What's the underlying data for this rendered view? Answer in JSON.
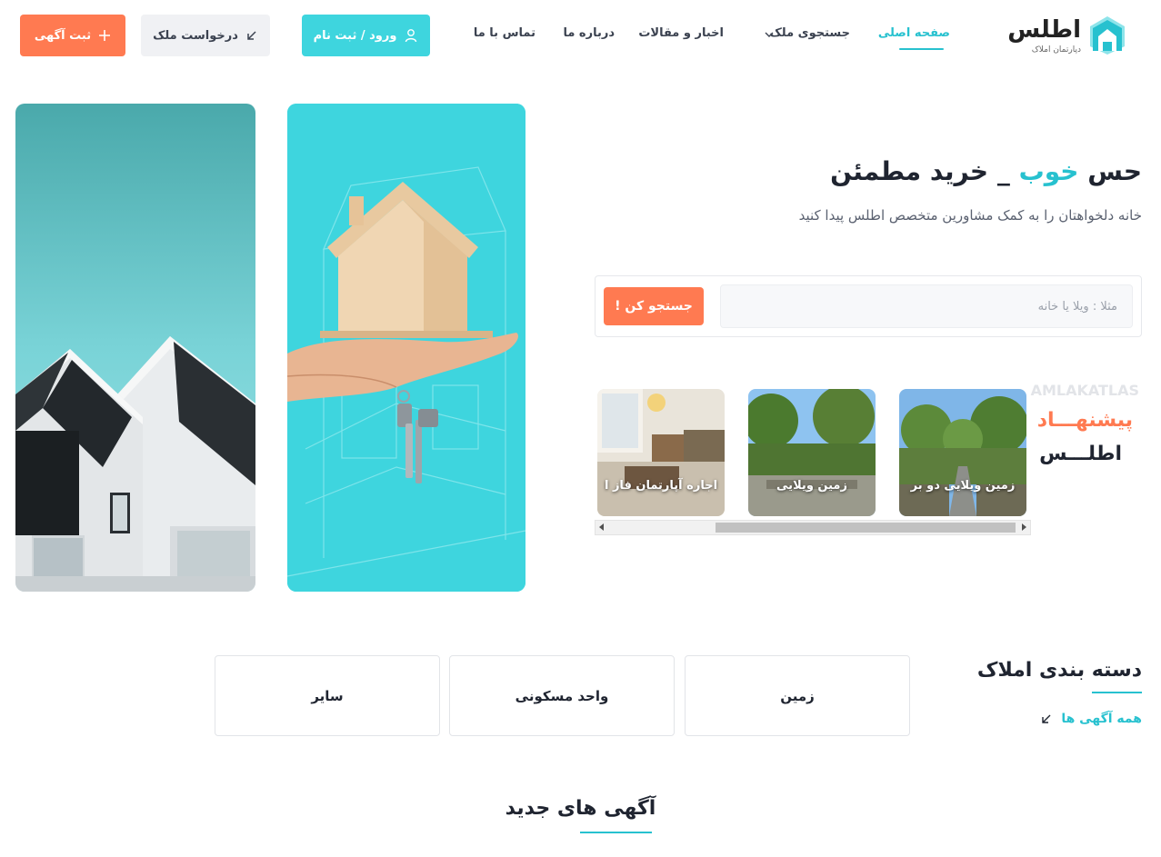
{
  "header": {
    "logo_text": "اطلس",
    "logo_sub": "دپارتمان املاک",
    "nav": [
      {
        "label": "صفحه اصلی",
        "active": true
      },
      {
        "label": "جستجوی ملک"
      },
      {
        "label": "اخبار و مقالات"
      },
      {
        "label": "درباره ما"
      },
      {
        "label": "تماس با ما"
      }
    ],
    "login_label": "ورود / ثبت نام",
    "request_label": "درخواست ملک",
    "add_label": "ثبت آگهی"
  },
  "hero": {
    "title_start": "حس ",
    "title_accent": "خوب",
    "title_end": " _ خرید مطمئن",
    "subtitle": "خانه دلخواهتان را به کمک مشاورین متخصص اطلس پیدا کنید",
    "search_placeholder": "مثلا : ویلا یا خانه",
    "search_button": "جستجو کن !"
  },
  "suggestions": {
    "watermark": "AMLAKATLAS",
    "line1": "پیشنهـــاد",
    "line2": "اطلـــس",
    "cards": [
      {
        "label": "زمین ویلایی دو بر"
      },
      {
        "label": "زمین ویلایی"
      },
      {
        "label": "اجاره آپارتمان فاز ا"
      }
    ]
  },
  "categories": {
    "title": "دسته بندی املاک",
    "all_link": "همه آگهی ها",
    "items": [
      "زمین",
      "واحد مسکونی",
      "سایر"
    ]
  },
  "new_ads": {
    "title": "آگهی های جدید"
  },
  "colors": {
    "accent": "#27c1cf",
    "cyan_button": "#3ed5de",
    "orange": "#ff7a51",
    "dark_text": "#1f2430"
  }
}
